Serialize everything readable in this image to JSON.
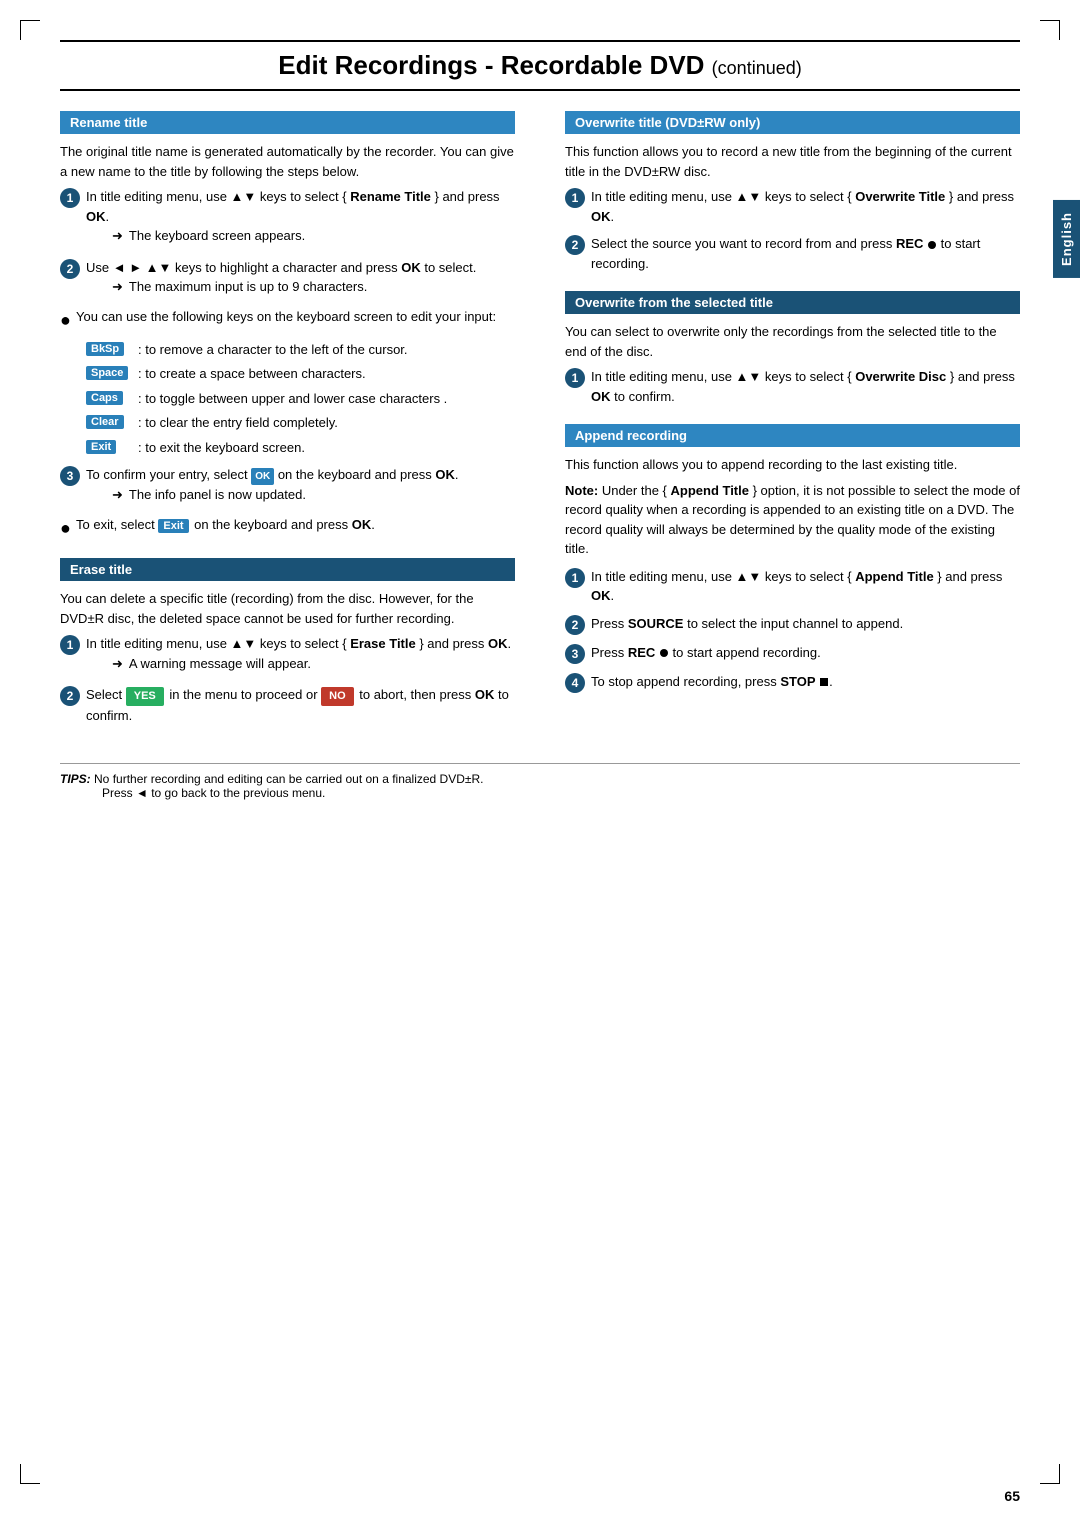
{
  "page": {
    "title": "Edit Recordings - Recordable DVD",
    "title_suffix": "continued",
    "page_number": "65",
    "language_tab": "English"
  },
  "tips": {
    "label": "TIPS:",
    "line1": "No further recording and editing can be carried out on a finalized DVD±R.",
    "line2": "Press ◄ to go back to the previous menu."
  },
  "left_col": {
    "rename_title": {
      "header": "Rename title",
      "intro": "The original title name is generated automatically by the recorder. You can give a new name to the title by following the steps below.",
      "steps": [
        {
          "num": "1",
          "text_parts": [
            "In title editing menu, use ▲▼ keys to select { ",
            "Rename Title",
            " } and press ",
            "OK",
            "."
          ],
          "arrow": "➜ The keyboard screen appears."
        },
        {
          "num": "2",
          "text_parts": [
            "Use ◄ ► ▲▼ keys to highlight a character and press ",
            "OK",
            " to select."
          ],
          "arrow": "➜ The maximum input is up to 9 characters."
        }
      ],
      "bullet_intro": "You can use the following keys on the keyboard screen to edit your input:",
      "keys": [
        {
          "badge": "BkSp",
          "badge_color": "blue",
          "desc": ": to remove a character to the left of the cursor."
        },
        {
          "badge": "Space",
          "badge_color": "blue",
          "desc": ": to create a space between characters."
        },
        {
          "badge": "Caps",
          "badge_color": "blue",
          "desc": ": to toggle between upper and lower case characters ."
        },
        {
          "badge": "Clear",
          "badge_color": "blue",
          "desc": ": to clear the entry field completely."
        },
        {
          "badge": "Exit",
          "badge_color": "blue",
          "desc": ": to exit the keyboard screen."
        }
      ],
      "step3": {
        "num": "3",
        "text_before": "To confirm your entry, select ",
        "badge": "OK",
        "text_after": " on the keyboard and press ",
        "bold": "OK",
        "text_end": ".",
        "arrow": "➜ The info panel is now updated."
      },
      "step_exit": {
        "text_before": "To exit, select ",
        "badge": "Exit",
        "text_after": " on the keyboard and press ",
        "bold": "OK",
        "text_end": "."
      }
    },
    "erase_title": {
      "header": "Erase title",
      "intro": "You can delete a specific title (recording) from the disc. However, for the DVD±R disc, the deleted space cannot be used for further recording.",
      "steps": [
        {
          "num": "1",
          "text_parts": [
            "In title editing menu, use ▲▼ keys to select { ",
            "Erase Title",
            " } and press ",
            "OK",
            "."
          ],
          "arrow": "➜ A warning message will appear."
        },
        {
          "num": "2",
          "text_before": "Select ",
          "badge_yes": "YES",
          "text_middle": " in the menu to proceed or ",
          "badge_no": "NO",
          "text_after": " to abort, then press ",
          "bold": "OK",
          "text_end": " to confirm."
        }
      ]
    }
  },
  "right_col": {
    "overwrite_title": {
      "header": "Overwrite title (DVD±RW only)",
      "intro": "This function allows you to record a new title from the beginning of the current title in the DVD±RW disc.",
      "steps": [
        {
          "num": "1",
          "text_parts": [
            "In title editing menu, use ▲▼ keys to select { ",
            "Overwrite Title",
            " } and press ",
            "OK",
            "."
          ]
        },
        {
          "num": "2",
          "text_before": "Select the source you want to record from and press ",
          "bold_rec": "REC",
          "text_after": " to start recording."
        }
      ]
    },
    "overwrite_selected": {
      "header": "Overwrite from the selected title",
      "intro": "You can select to overwrite only the recordings from the selected title to the end of the disc.",
      "steps": [
        {
          "num": "1",
          "text_parts": [
            "In title editing menu, use ▲▼ keys to select { ",
            "Overwrite Disc",
            " } and press ",
            "OK",
            " to confirm."
          ]
        }
      ]
    },
    "append_recording": {
      "header": "Append recording",
      "intro": "This function allows you to append recording to the last existing title.",
      "note_bold": "Note:",
      "note_text": " Under the { ",
      "note_bold2": "Append Title",
      "note_text2": " } option, it is not possible to select the mode of record quality when a recording is appended to an existing title on a DVD. The record quality will always be determined by the quality mode of the existing title.",
      "steps": [
        {
          "num": "1",
          "text_parts": [
            "In title editing menu, use ▲▼ keys to select { ",
            "Append Title",
            " } and press ",
            "OK",
            "."
          ]
        },
        {
          "num": "2",
          "text_before": "Press ",
          "bold": "SOURCE",
          "text_after": " to select the input channel to append."
        },
        {
          "num": "3",
          "text_before": "Press ",
          "bold_rec": "REC",
          "text_after": " to start append recording."
        },
        {
          "num": "4",
          "text_before": "To stop append recording, press ",
          "bold_stop": "STOP",
          "text_after": " ■."
        }
      ]
    }
  }
}
